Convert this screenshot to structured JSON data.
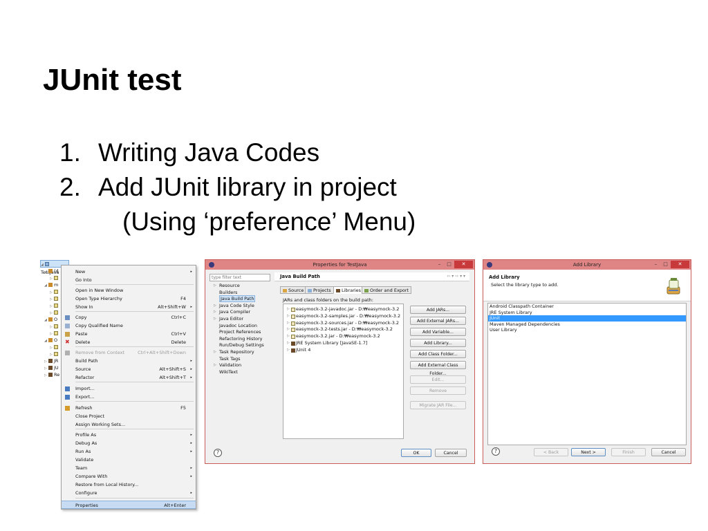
{
  "slide": {
    "title": "JUnit test",
    "steps": [
      {
        "num": "1.",
        "text": "Writing Java Codes"
      },
      {
        "num": "2.",
        "text": "Add JUnit library in project"
      }
    ],
    "step_sub": "(Using ‘preference’ Menu)"
  },
  "explorer": {
    "root": "TestJava",
    "rows": [
      {
        "label": "(d",
        "icon": "package-icon"
      },
      {
        "label": "",
        "icon": "java-file-icon"
      },
      {
        "label": "m",
        "icon": "package-icon"
      },
      {
        "label": "",
        "icon": "java-file-icon"
      },
      {
        "label": "",
        "icon": "java-file-icon"
      },
      {
        "label": "",
        "icon": "java-file-icon"
      },
      {
        "label": "",
        "icon": "java-file-icon"
      },
      {
        "label": "O",
        "icon": "package-icon"
      },
      {
        "label": "",
        "icon": "java-file-icon"
      },
      {
        "label": "",
        "icon": "java-file-icon"
      },
      {
        "label": "O",
        "icon": "package-icon"
      },
      {
        "label": "",
        "icon": "java-file-icon"
      },
      {
        "label": "",
        "icon": "java-file-icon"
      },
      {
        "label": "JR",
        "icon": "library-icon"
      },
      {
        "label": "JU",
        "icon": "library-icon"
      },
      {
        "label": "Re",
        "icon": "library-icon"
      }
    ]
  },
  "context_menu": {
    "items": [
      {
        "label": "New",
        "shortcut": "",
        "arrow": "▸"
      },
      {
        "label": "Go Into",
        "shortcut": "",
        "arrow": ""
      },
      {
        "label": "Open in New Window",
        "shortcut": "",
        "arrow": ""
      },
      {
        "label": "Open Type Hierarchy",
        "shortcut": "F4",
        "arrow": ""
      },
      {
        "label": "Show In",
        "shortcut": "Alt+Shift+W",
        "arrow": "▸"
      },
      {
        "label": "Copy",
        "shortcut": "Ctrl+C",
        "arrow": ""
      },
      {
        "label": "Copy Qualified Name",
        "shortcut": "",
        "arrow": ""
      },
      {
        "label": "Paste",
        "shortcut": "Ctrl+V",
        "arrow": ""
      },
      {
        "label": "Delete",
        "shortcut": "Delete",
        "arrow": ""
      },
      {
        "label": "Remove from Context",
        "shortcut": "Ctrl+Alt+Shift+Down",
        "arrow": ""
      },
      {
        "label": "Build Path",
        "shortcut": "",
        "arrow": "▸"
      },
      {
        "label": "Source",
        "shortcut": "Alt+Shift+S",
        "arrow": "▸"
      },
      {
        "label": "Refactor",
        "shortcut": "Alt+Shift+T",
        "arrow": "▸"
      },
      {
        "label": "Import...",
        "shortcut": "",
        "arrow": ""
      },
      {
        "label": "Export...",
        "shortcut": "",
        "arrow": ""
      },
      {
        "label": "Refresh",
        "shortcut": "F5",
        "arrow": ""
      },
      {
        "label": "Close Project",
        "shortcut": "",
        "arrow": ""
      },
      {
        "label": "Assign Working Sets...",
        "shortcut": "",
        "arrow": ""
      },
      {
        "label": "Profile As",
        "shortcut": "",
        "arrow": "▸"
      },
      {
        "label": "Debug As",
        "shortcut": "",
        "arrow": "▸"
      },
      {
        "label": "Run As",
        "shortcut": "",
        "arrow": "▸"
      },
      {
        "label": "Validate",
        "shortcut": "",
        "arrow": ""
      },
      {
        "label": "Team",
        "shortcut": "",
        "arrow": "▸"
      },
      {
        "label": "Compare With",
        "shortcut": "",
        "arrow": "▸"
      },
      {
        "label": "Restore from Local History...",
        "shortcut": "",
        "arrow": ""
      },
      {
        "label": "Configure",
        "shortcut": "",
        "arrow": "▸"
      },
      {
        "label": "Properties",
        "shortcut": "Alt+Enter",
        "arrow": ""
      }
    ]
  },
  "properties": {
    "title": "Properties for TestJava",
    "filter_placeholder": "type filter text",
    "nav": [
      {
        "label": "Resource",
        "expand": "▷"
      },
      {
        "label": "Builders",
        "expand": ""
      },
      {
        "label": "Java Build Path",
        "expand": ""
      },
      {
        "label": "Java Code Style",
        "expand": "▷"
      },
      {
        "label": "Java Compiler",
        "expand": "▷"
      },
      {
        "label": "Java Editor",
        "expand": "▷"
      },
      {
        "label": "Javadoc Location",
        "expand": ""
      },
      {
        "label": "Project References",
        "expand": ""
      },
      {
        "label": "Refactoring History",
        "expand": ""
      },
      {
        "label": "Run/Debug Settings",
        "expand": ""
      },
      {
        "label": "Task Repository",
        "expand": "▷"
      },
      {
        "label": "Task Tags",
        "expand": ""
      },
      {
        "label": "Validation",
        "expand": "▷"
      },
      {
        "label": "WikiText",
        "expand": ""
      }
    ],
    "page_title": "Java Build Path",
    "nav_arrows": "⇦ ▾ ⇨ ▾ ▾",
    "tabs": [
      "Source",
      "Projects",
      "Libraries",
      "Order and Export"
    ],
    "description": "JARs and class folders on the build path:",
    "jars": [
      {
        "label": "easymock-3.2-javadoc.jar - D:₩easymock-3.2",
        "kind": "jar"
      },
      {
        "label": "easymock-3.2-samples.jar - D:₩easymock-3.2",
        "kind": "jar"
      },
      {
        "label": "easymock-3.2-sources.jar - D:₩easymock-3.2",
        "kind": "jar"
      },
      {
        "label": "easymock-3.2-tests.jar - D:₩easymock-3.2",
        "kind": "jar"
      },
      {
        "label": "easymock-3.2.jar - D:₩easymock-3.2",
        "kind": "jar"
      },
      {
        "label": "JRE System Library [JavaSE-1.7]",
        "kind": "lib"
      },
      {
        "label": "JUnit 4",
        "kind": "lib"
      }
    ],
    "buttons": {
      "add_jars": "Add JARs...",
      "add_external_jars": "Add External JARs...",
      "add_variable": "Add Variable...",
      "add_library": "Add Library...",
      "add_class_folder": "Add Class Folder...",
      "add_external_class_folder": "Add External Class Folder...",
      "edit": "Edit...",
      "remove": "Remove",
      "migrate": "Migrate JAR File..."
    },
    "ok": "OK",
    "cancel": "Cancel",
    "help": "?"
  },
  "add_library": {
    "title": "Add Library",
    "header_title": "Add Library",
    "header_desc": "Select the library type to add.",
    "items": [
      "Android Classpath Container",
      "JRE System Library",
      "JUnit",
      "Maven Managed Dependencies",
      "User Library"
    ],
    "selected_index": 2,
    "back": "< Back",
    "next": "Next >",
    "finish": "Finish",
    "cancel": "Cancel",
    "help": "?"
  },
  "window_controls": {
    "min": "–",
    "max": "□",
    "close": "✕"
  },
  "colors": {
    "titlebar": "#e08585",
    "close_button": "#c7393a",
    "selection": "#3399ff"
  }
}
